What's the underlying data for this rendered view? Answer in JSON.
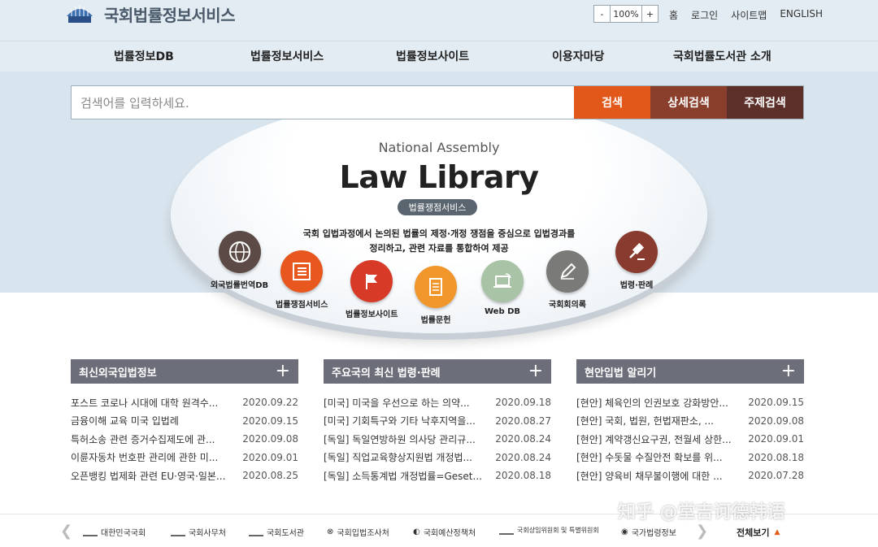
{
  "header": {
    "logo_text": "국회법률정보서비스",
    "zoom": {
      "minus": "-",
      "value": "100%",
      "plus": "+"
    },
    "utils": [
      "홈",
      "로그인",
      "사이트맵",
      "ENGLISH"
    ]
  },
  "gnb": [
    "법률정보DB",
    "법률정보서비스",
    "법률정보사이트",
    "이용자마당",
    "국회법률도서관 소개"
  ],
  "search": {
    "placeholder": "검색어를 입력하세요.",
    "search_btn": "검색",
    "advanced_btn": "상세검색",
    "subject_btn": "주제검색",
    "colors": {
      "search": "#e2581a",
      "advanced": "#8a3f2d",
      "subject": "#5c2f28"
    }
  },
  "hero": {
    "subtitle": "National Assembly",
    "title": "Law Library",
    "pill": "법률쟁점서비스",
    "desc_line1": "국회 입법과정에서 논의된 법률의 제정·개정 쟁점을 중심으로 입법경과를",
    "desc_line2": "정리하고, 관련 자료를 통합하여 제공"
  },
  "services": [
    {
      "label": "외국법률번역DB",
      "icon": "globe-icon",
      "color": "#5b4a45"
    },
    {
      "label": "법률쟁점서비스",
      "icon": "list-icon",
      "color": "#e8581e"
    },
    {
      "label": "법률정보사이트",
      "icon": "flag-icon",
      "color": "#d83a28"
    },
    {
      "label": "법률문헌",
      "icon": "document-icon",
      "color": "#f0962b"
    },
    {
      "label": "Web DB",
      "icon": "laptop-icon",
      "color": "#a9c3a6"
    },
    {
      "label": "국회회의록",
      "icon": "pen-icon",
      "color": "#7a7a78"
    },
    {
      "label": "법령·판례",
      "icon": "gavel-icon",
      "color": "#8a3b2f"
    }
  ],
  "columns": [
    {
      "title": "최신외국입법정보",
      "plus": "+",
      "rows": [
        {
          "t": "포스트 코로나 시대에 대학 원격수...",
          "d": "2020.09.22"
        },
        {
          "t": "금융이해 교육 미국 입법례",
          "d": "2020.09.15"
        },
        {
          "t": "특허소송 관련 증거수집제도에 관...",
          "d": "2020.09.08"
        },
        {
          "t": "이륜자동차 번호판 관리에 관한 미...",
          "d": "2020.09.01"
        },
        {
          "t": "오픈뱅킹 법제화 관련 EU·영국·일본...",
          "d": "2020.08.25"
        }
      ]
    },
    {
      "title": "주요국의 최신 법령·판례",
      "plus": "+",
      "rows": [
        {
          "t": "[미국] 미국을 우선으로 하는 의약...",
          "d": "2020.09.18"
        },
        {
          "t": "[미국] 기회특구와 기타 낙후지역을...",
          "d": "2020.08.27"
        },
        {
          "t": "[독일] 독일연방하원 의사당 관리규...",
          "d": "2020.08.24"
        },
        {
          "t": "[독일] 직업교육향상지원법 개정법...",
          "d": "2020.08.24"
        },
        {
          "t": "[독일] 소득통계법 개정법률=Geset...",
          "d": "2020.08.18"
        }
      ]
    },
    {
      "title": "현안입법 알리기",
      "plus": "+",
      "rows": [
        {
          "t": "[현안] 체육인의 인권보호 강화방안...",
          "d": "2020.09.15"
        },
        {
          "t": "[현안] 국회, 법원, 헌법재판소, ...",
          "d": "2020.09.08"
        },
        {
          "t": "[현안] 계약갱신요구권, 전월세 상한...",
          "d": "2020.09.01"
        },
        {
          "t": "[현안] 수돗물 수질안전 확보를 위...",
          "d": "2020.08.18"
        },
        {
          "t": "[현안] 양육비 채무불이행에 대한 ...",
          "d": "2020.07.28"
        }
      ]
    }
  ],
  "footer": {
    "links": [
      "대한민국국회",
      "국회사무처",
      "국회도서관",
      "국회입법조사처",
      "국회예산정책처",
      "국회상임위원회 및 특별위원회",
      "국가법령정보"
    ],
    "view_all": "전체보기"
  },
  "watermark": "知乎 @堂吉诃德韩语"
}
